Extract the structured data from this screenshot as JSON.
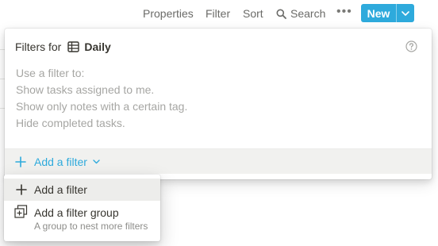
{
  "toolbar": {
    "properties": "Properties",
    "filter": "Filter",
    "sort": "Sort",
    "search": "Search",
    "more": "•••",
    "new_label": "New"
  },
  "filter_panel": {
    "title": "Filters for",
    "database_name": "Daily",
    "hint_title": "Use a filter to:",
    "hints": [
      "Show tasks assigned to me.",
      "Show only notes with a certain tag.",
      "Hide completed tasks."
    ],
    "add_filter": "Add a filter"
  },
  "add_menu": {
    "items": [
      {
        "label": "Add a filter",
        "icon": "plus-icon"
      },
      {
        "label": "Add a filter group",
        "description": "A group to nest more filters",
        "icon": "filter-group-icon"
      }
    ]
  },
  "colors": {
    "accent": "#2eaadc",
    "text": "#37352f",
    "muted": "#a6a6a3",
    "footer_bg": "#f1f1ef",
    "hover_bg": "#ededeb"
  }
}
